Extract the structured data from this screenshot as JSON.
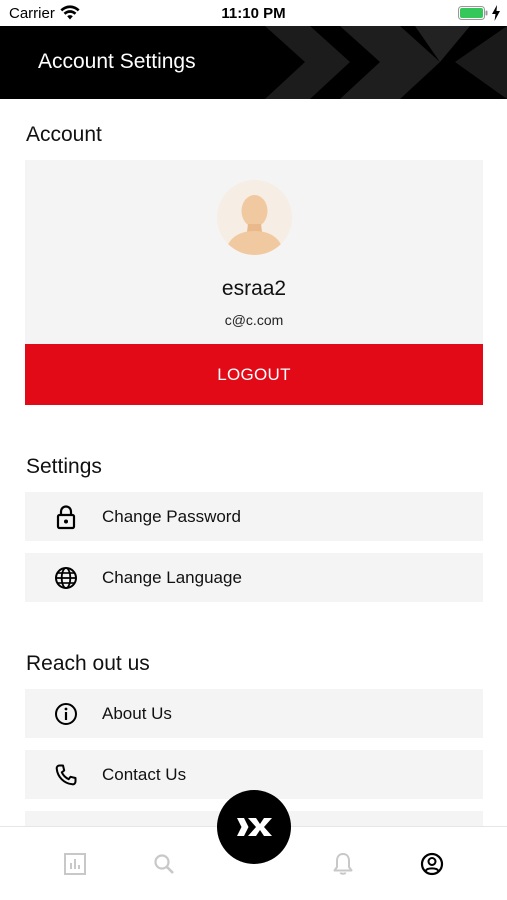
{
  "status_bar": {
    "carrier": "Carrier",
    "time": "11:10 PM",
    "battery_color": "#34c759"
  },
  "header": {
    "title": "Account Settings",
    "background": "#000000"
  },
  "account": {
    "section_title": "Account",
    "avatar_icon": "default-user-avatar",
    "username": "esraa2",
    "email": "c@c.com",
    "logout_label": "LOGOUT",
    "logout_color": "#e20a17"
  },
  "settings": {
    "section_title": "Settings",
    "items": [
      {
        "label": "Change Password",
        "icon": "lock-icon"
      },
      {
        "label": "Change Language",
        "icon": "globe-icon"
      }
    ]
  },
  "reach_out": {
    "section_title": "Reach out us",
    "items": [
      {
        "label": "About Us",
        "icon": "info-icon"
      },
      {
        "label": "Contact Us",
        "icon": "phone-icon"
      }
    ]
  },
  "tab_bar": {
    "tabs": [
      {
        "icon": "chart-icon",
        "active": false
      },
      {
        "icon": "search-icon",
        "active": false
      },
      {
        "icon": "brand-logo-icon",
        "active": false
      },
      {
        "icon": "bell-icon",
        "active": false
      },
      {
        "icon": "profile-icon",
        "active": true
      }
    ]
  }
}
